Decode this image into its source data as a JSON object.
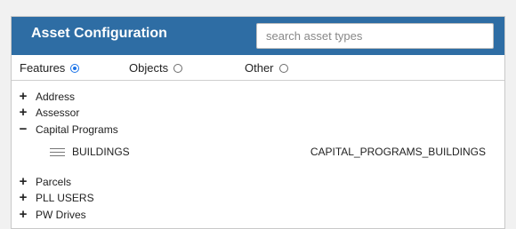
{
  "header": {
    "title": "Asset Configuration",
    "search_placeholder": "search asset types"
  },
  "filters": [
    {
      "label": "Features",
      "checked": true
    },
    {
      "label": "Objects",
      "checked": false
    },
    {
      "label": "Other",
      "checked": false
    }
  ],
  "tree": [
    {
      "label": "Address",
      "expanded": false,
      "toggle": "+"
    },
    {
      "label": "Assessor",
      "expanded": false,
      "toggle": "+"
    },
    {
      "label": "Capital Programs",
      "expanded": true,
      "toggle": "−",
      "children": [
        {
          "name": "BUILDINGS",
          "code": "CAPITAL_PROGRAMS_BUILDINGS"
        }
      ]
    },
    {
      "label": "Parcels",
      "expanded": false,
      "toggle": "+"
    },
    {
      "label": "PLL USERS",
      "expanded": false,
      "toggle": "+"
    },
    {
      "label": "PW Drives",
      "expanded": false,
      "toggle": "+"
    }
  ],
  "colors": {
    "header_bg": "#2e6da4",
    "accent": "#1a73e8"
  }
}
